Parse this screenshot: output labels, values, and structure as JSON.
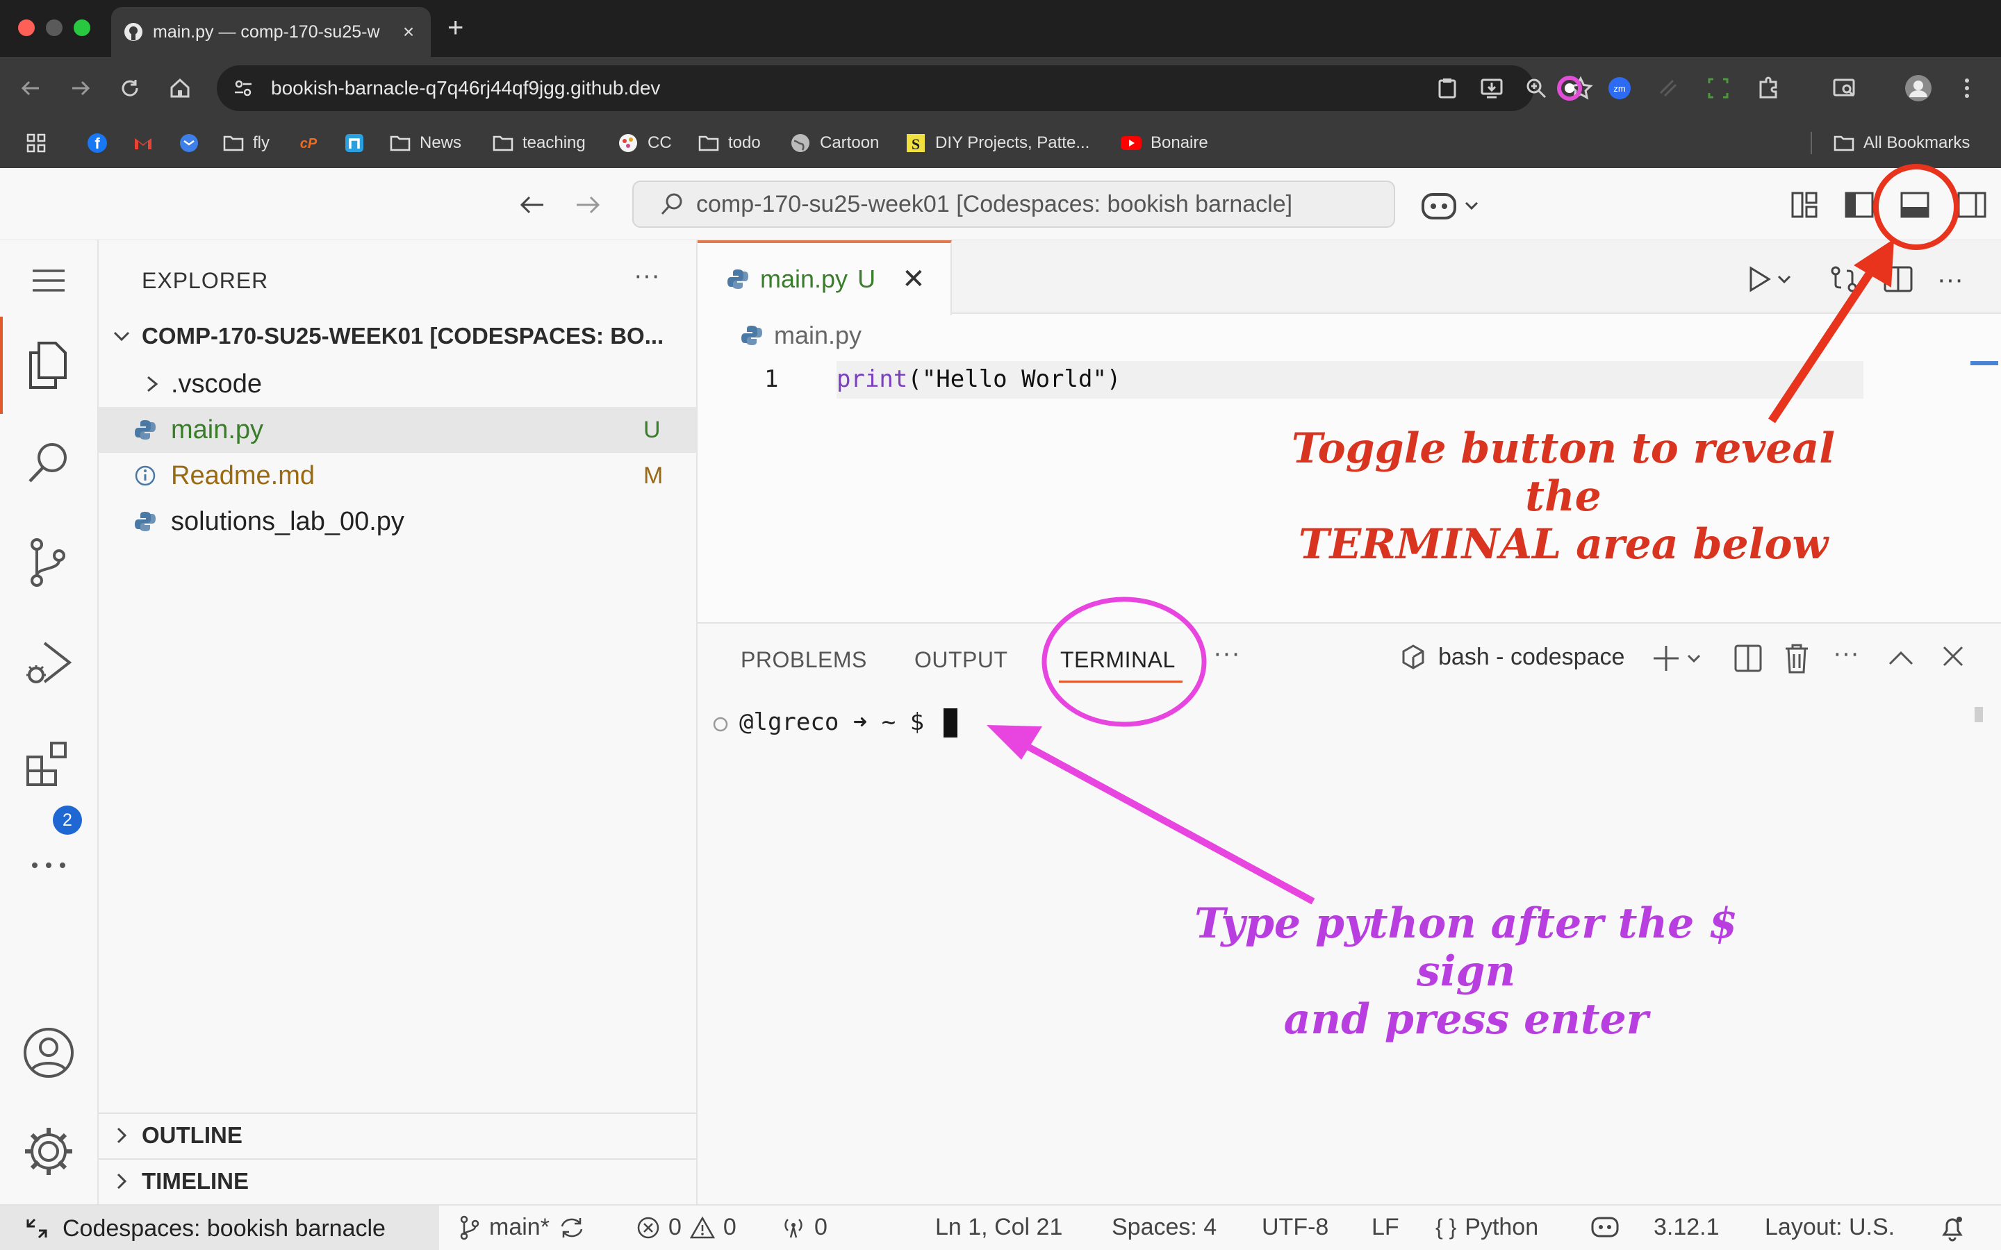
{
  "browser": {
    "tab_title": "main.py — comp-170-su25-w",
    "url": "bookish-barnacle-q7q46rj44qf9jgg.github.dev",
    "bookmarks": [
      "fly",
      "News",
      "teaching",
      "CC",
      "todo",
      "Cartoon",
      "DIY Projects, Patte...",
      "Bonaire"
    ],
    "all_bookmarks": "All Bookmarks"
  },
  "vscode": {
    "command_center": "comp-170-su25-week01 [Codespaces: bookish barnacle]",
    "explorer": {
      "title": "EXPLORER",
      "root": "COMP-170-SU25-WEEK01 [CODESPACES: BO...",
      "items": [
        {
          "name": ".vscode",
          "status": "",
          "color": "#222222"
        },
        {
          "name": "main.py",
          "status": "U",
          "color": "#3a7d2a"
        },
        {
          "name": "Readme.md",
          "status": "M",
          "color": "#9a6a12"
        },
        {
          "name": "solutions_lab_00.py",
          "status": "",
          "color": "#222222"
        }
      ],
      "outline": "OUTLINE",
      "timeline": "TIMELINE"
    },
    "source_control_badge": "2",
    "editor": {
      "tab_label": "main.py",
      "tab_status": "U",
      "breadcrumb": "main.py",
      "line_number": "1",
      "code_fn": "print",
      "code_rest": "(\"Hello World\")"
    },
    "panel": {
      "tabs": [
        "PROBLEMS",
        "OUTPUT",
        "TERMINAL"
      ],
      "active_tab": "TERMINAL",
      "terminal_name": "bash - codespace",
      "prompt": "@lgreco ➜ ~ $"
    },
    "statusbar": {
      "remote": "Codespaces: bookish barnacle",
      "branch": "main*",
      "errors": "0",
      "warnings": "0",
      "ports": "0",
      "position": "Ln 1, Col 21",
      "spaces": "Spaces: 4",
      "encoding": "UTF-8",
      "eol": "LF",
      "language": "Python",
      "python_version": "3.12.1",
      "layout": "Layout: U.S."
    }
  },
  "annotations": {
    "toggle_note_line1": "Toggle button to reveal the",
    "toggle_note_line2": "TERMINAL area below",
    "type_note_line1": "Type python after the $ sign",
    "type_note_line2": "and press enter",
    "red_color": "#e8341c",
    "pink_color": "#e845e0"
  }
}
